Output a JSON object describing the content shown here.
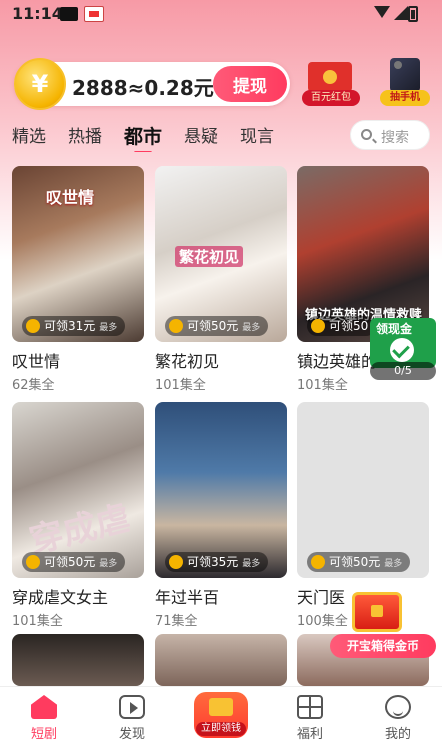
{
  "status_bar": {
    "time": "11:14"
  },
  "rewards": {
    "coin_symbol": "¥",
    "balance_text": "2888≈0.28元",
    "withdraw_label": "提现",
    "red_packet_label": "百元红包",
    "phone_label": "抽手机"
  },
  "tabs": [
    {
      "label": "精选",
      "active": false
    },
    {
      "label": "热播",
      "active": false
    },
    {
      "label": "都市",
      "active": true
    },
    {
      "label": "悬疑",
      "active": false
    },
    {
      "label": "现言",
      "active": false
    }
  ],
  "search": {
    "label": "搜索"
  },
  "dramas": [
    {
      "title": "叹世情",
      "episodes": "62集全",
      "reward": "可领31元",
      "reward_tag": "最多",
      "poster_text": "叹世情"
    },
    {
      "title": "繁花初见",
      "episodes": "101集全",
      "reward": "可领50元",
      "reward_tag": "最多",
      "poster_text": "繁花初见"
    },
    {
      "title": "镇边英雄的",
      "episodes": "101集全",
      "reward": "可领50",
      "reward_tag": "",
      "poster_text": "镇边英雄的温情救赎"
    },
    {
      "title": "穿成虐文女主",
      "episodes": "101集全",
      "reward": "可领50元",
      "reward_tag": "最多",
      "poster_text": "穿成虐"
    },
    {
      "title": "年过半百",
      "episodes": "71集全",
      "reward": "可领35元",
      "reward_tag": "最多",
      "poster_text": ""
    },
    {
      "title": "天门医",
      "episodes": "100集全",
      "reward": "可领50元",
      "reward_tag": "最多",
      "poster_text": ""
    }
  ],
  "floating": {
    "gold_label": "领现金",
    "gold_count": "0/5",
    "chest_label": "开宝箱得金币"
  },
  "bottom_nav": [
    {
      "label": "短剧",
      "icon": "home-icon",
      "active": true
    },
    {
      "label": "发现",
      "icon": "play-square-icon",
      "active": false
    },
    {
      "label": "立即领钱",
      "icon": "red-envelope-icon",
      "active": false
    },
    {
      "label": "福利",
      "icon": "gift-icon",
      "active": false
    },
    {
      "label": "我的",
      "icon": "smile-icon",
      "active": false
    }
  ],
  "colors": {
    "accent": "#ff3b5f",
    "coin": "#f5b400",
    "green": "#1fa04a"
  }
}
